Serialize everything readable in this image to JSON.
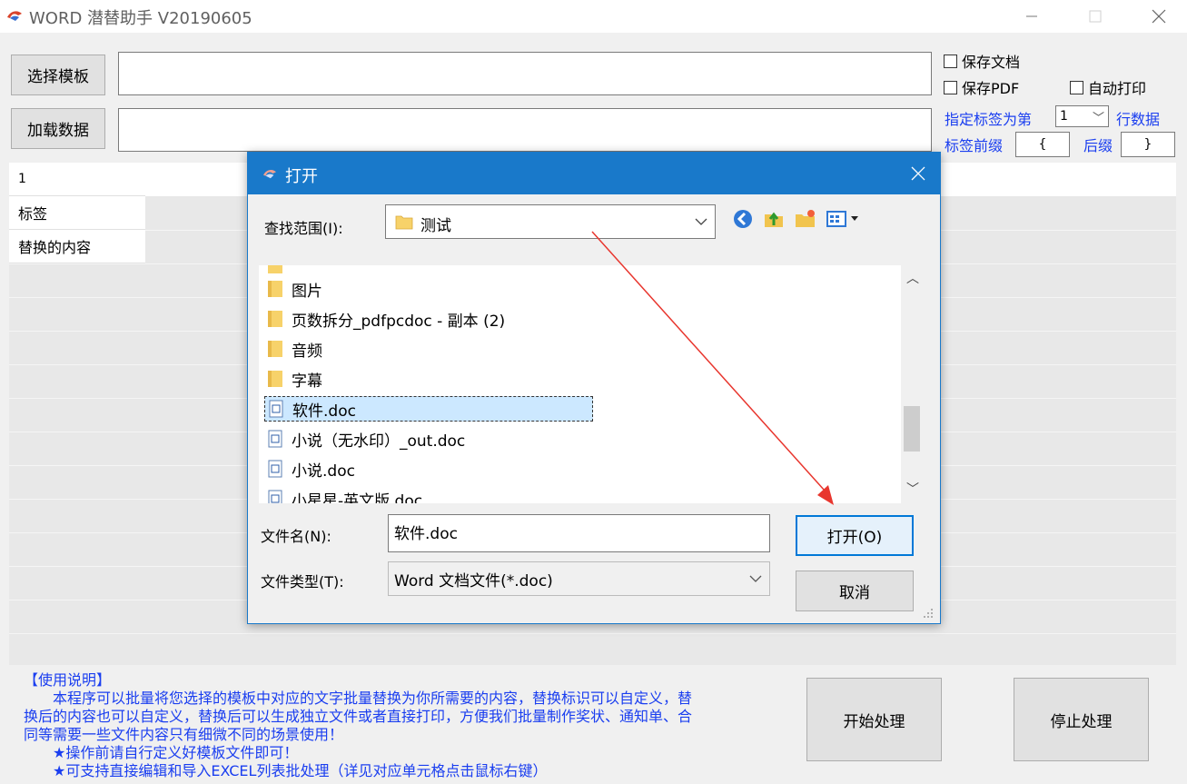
{
  "app": {
    "title": "WORD 潜替助手 V20190605"
  },
  "main": {
    "select_template_label": "选择模板",
    "load_data_label": "加载数据",
    "template_path": "",
    "data_path": ""
  },
  "options": {
    "save_doc": "保存文档",
    "save_pdf": "保存PDF",
    "auto_print": "自动打印",
    "tag_row_prefix": "指定标签为第",
    "tag_row_value": "1",
    "tag_row_suffix": "行数据",
    "tag_prefix_label": "标签前缀",
    "prefix_value": "{",
    "suffix_label": "后缀",
    "suffix_value": "}"
  },
  "grid": {
    "rows": [
      "1",
      "标签",
      "替换的内容"
    ]
  },
  "instructions": {
    "line1": "【使用说明】",
    "line2": "　　本程序可以批量将您选择的模板中对应的文字批量替换为你所需要的内容，替换标识可以自定义，替",
    "line3": "换后的内容也可以自定义，替换后可以生成独立文件或者直接打印，方便我们批量制作奖状、通知单、合",
    "line4": "同等需要一些文件内容只有细微不同的场景使用！",
    "line5": "　　★操作前请自行定义好模板文件即可！",
    "line6": "　　★可支持直接编辑和导入EXCEL列表批处理（详见对应单元格点击鼠标右键）"
  },
  "actions": {
    "start_label": "开始处理",
    "stop_label": "停止处理"
  },
  "dialog": {
    "title": "打开",
    "lookin_label": "查找范围(I):",
    "lookin_value": "测试",
    "files": [
      {
        "name": "图片",
        "type": "folder"
      },
      {
        "name": "页数拆分_pdfpcdoc - 副本 (2)",
        "type": "folder"
      },
      {
        "name": "音频",
        "type": "folder"
      },
      {
        "name": "字幕",
        "type": "folder"
      },
      {
        "name": "软件.doc",
        "type": "doc",
        "selected": true
      },
      {
        "name": "小说（无水印）_out.doc",
        "type": "doc"
      },
      {
        "name": "小说.doc",
        "type": "doc"
      },
      {
        "name": "小星星-英文版.doc",
        "type": "doc"
      }
    ],
    "filename_label": "文件名(N):",
    "filename_value": "软件.doc",
    "filetype_label": "文件类型(T):",
    "filetype_value": "Word 文档文件(*.doc)",
    "open_label": "打开(O)",
    "cancel_label": "取消"
  },
  "colors": {
    "dialog_title_bg": "#1979ca",
    "instruction_text": "#1a3ef0",
    "annotation_arrow": "#e8362e"
  }
}
